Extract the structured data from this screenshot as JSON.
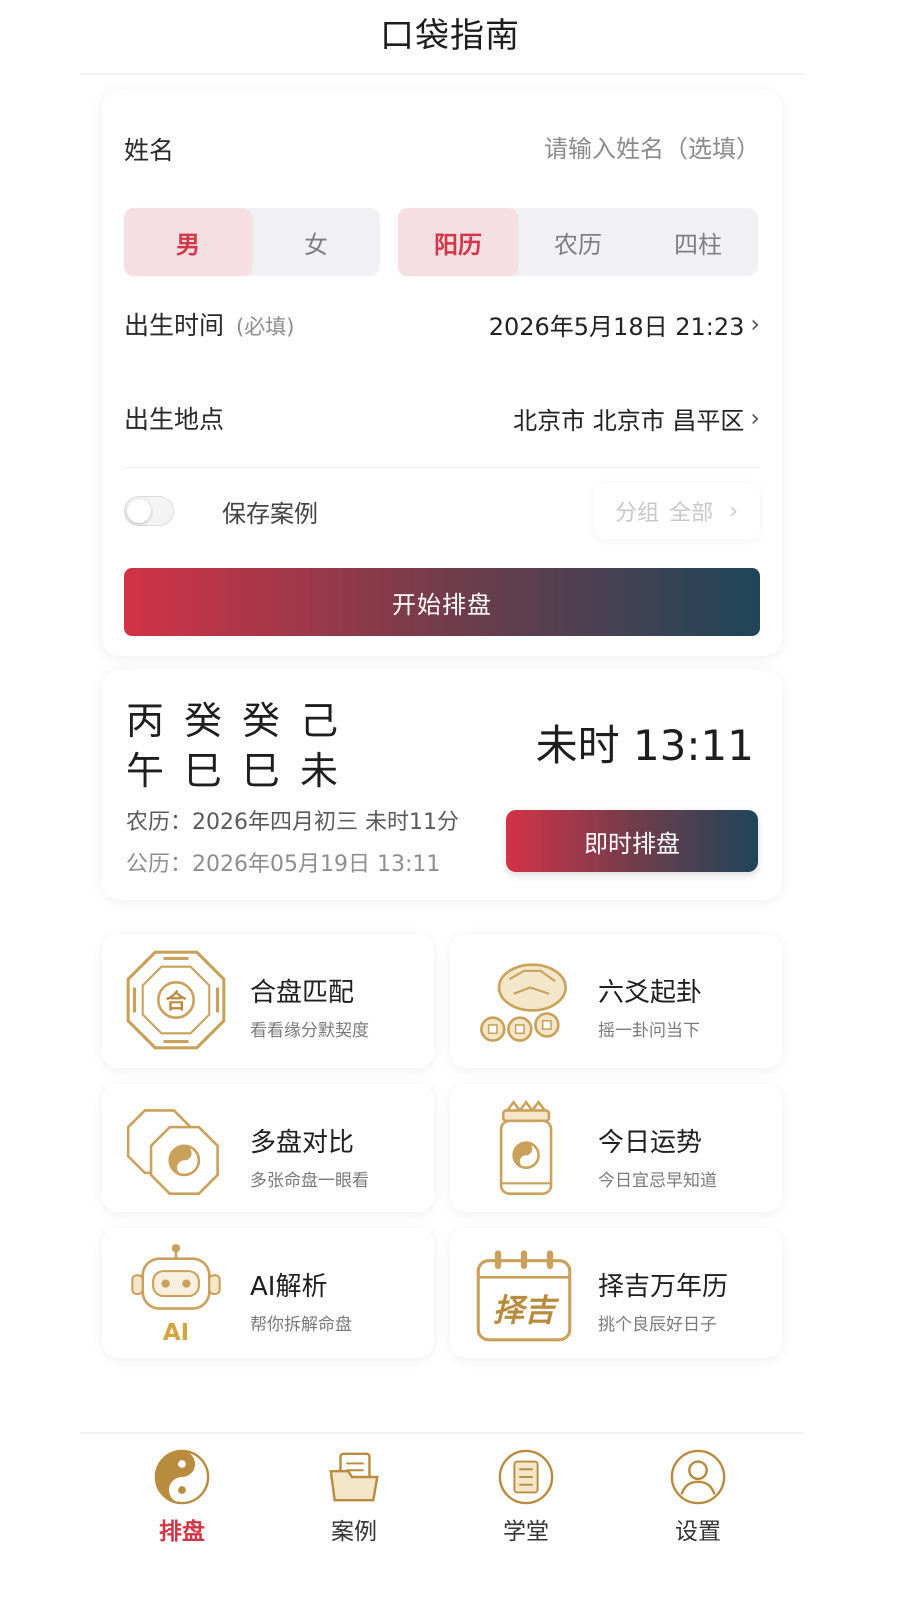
{
  "header": {
    "title": "口袋指南"
  },
  "form": {
    "name_label": "姓名",
    "name_value": "",
    "name_placeholder": "请输入姓名（选填）",
    "gender_options": [
      "男",
      "女"
    ],
    "gender_selected": "男",
    "calendar_options": [
      "阳历",
      "农历",
      "四柱"
    ],
    "calendar_selected": "阳历",
    "birth_time_label": "出生时间",
    "birth_time_note": "(必填)",
    "birth_time_value": "2026年5月18日 21:23",
    "birth_place_label": "出生地点",
    "birth_place_value": "北京市 北京市 昌平区",
    "save_case_label": "保存案例",
    "save_case_on": false,
    "group_label": "分组",
    "group_value": "全部",
    "start_button": "开始排盘"
  },
  "pillars": {
    "stems": "丙癸癸己",
    "branches": "午巳巳未",
    "current_time": "未时 13:11",
    "lunar_date": "农历：2026年四月初三 未时11分",
    "solar_date": "公历：2026年05月19日 13:11",
    "instant_button": "即时排盘"
  },
  "features": [
    {
      "title": "合盘匹配",
      "subtitle": "看看缘分默契度",
      "icon": "bagua-he-icon"
    },
    {
      "title": "六爻起卦",
      "subtitle": "摇一卦问当下",
      "icon": "coins-tortoise-icon"
    },
    {
      "title": "多盘对比",
      "subtitle": "多张命盘一眼看",
      "icon": "bagua-compare-icon"
    },
    {
      "title": "今日运势",
      "subtitle": "今日宜忌早知道",
      "icon": "fortune-jar-icon"
    },
    {
      "title": "AI解析",
      "subtitle": "帮你拆解命盘",
      "icon": "ai-robot-icon",
      "icon_text": "AI"
    },
    {
      "title": "择吉万年历",
      "subtitle": "挑个良辰好日子",
      "icon": "calendar-zeji-icon",
      "icon_text": "择吉"
    }
  ],
  "bagua_center_text": "合",
  "nav": [
    {
      "label": "排盘",
      "icon": "yin-yang-icon",
      "active": true
    },
    {
      "label": "案例",
      "icon": "folder-icon",
      "active": false
    },
    {
      "label": "学堂",
      "icon": "book-icon",
      "active": false
    },
    {
      "label": "设置",
      "icon": "user-icon",
      "active": false
    }
  ],
  "colors": {
    "accent_red": "#d0384a",
    "gold": "#c9a15a",
    "gradient_end": "#1f4559"
  }
}
